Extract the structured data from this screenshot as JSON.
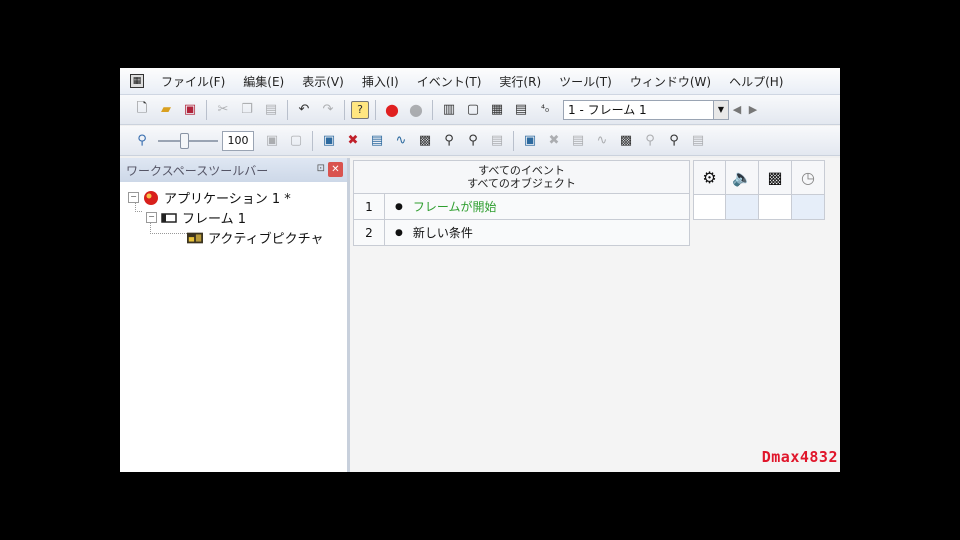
{
  "menubar": {
    "items": [
      "ファイル(F)",
      "編集(E)",
      "表示(V)",
      "挿入(I)",
      "イベント(T)",
      "実行(R)",
      "ツール(T)",
      "ウィンドウ(W)",
      "ヘルプ(H)"
    ]
  },
  "toolbar1": {
    "frame_select_value": "1 - フレーム 1"
  },
  "toolbar2": {
    "zoom_value": "100"
  },
  "workspace": {
    "title": "ワークスペースツールバー",
    "tree": {
      "application": "アプリケーション 1 *",
      "frame": "フレーム 1",
      "object": "アクティブピクチャ"
    }
  },
  "event_editor": {
    "header_line1": "すべてのイベント",
    "header_line2": "すべてのオブジェクト",
    "events": [
      {
        "num": "1",
        "text": "フレームが開始"
      },
      {
        "num": "2",
        "text": "新しい条件"
      }
    ]
  },
  "watermark": "Dmax4832",
  "colors": {
    "event_green": "#2e9e2e",
    "watermark_red": "#e0162b",
    "close_red": "#d9534f"
  }
}
